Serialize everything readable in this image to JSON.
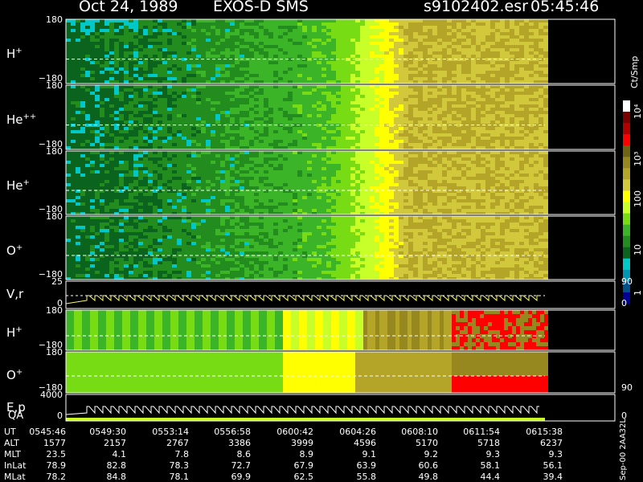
{
  "header": {
    "date": "Oct 24, 1989",
    "instrument": "EXOS-D SMS",
    "file": "s9102402.esr",
    "time": "05:45:46"
  },
  "colorbar": {
    "unit": "Ct/Smp",
    "labels": [
      "10⁴",
      "10³",
      "100",
      "10",
      "1"
    ],
    "colors": [
      "#ffffff",
      "#7a0000",
      "#b00000",
      "#ff0000",
      "#6e6414",
      "#96871e",
      "#b4a528",
      "#d2c83c",
      "#ffff00",
      "#c8ff28",
      "#78dc14",
      "#3cb428",
      "#228c1e",
      "#0a641e",
      "#00c8c8",
      "#0096b4",
      "#00508c",
      "#000096"
    ]
  },
  "panels": [
    {
      "name": "H",
      "sup": "+",
      "ytop": "180",
      "ybot": "−180"
    },
    {
      "name": "He",
      "sup": "++",
      "ytop": "180",
      "ybot": "−180"
    },
    {
      "name": "He",
      "sup": "+",
      "ytop": "180",
      "ybot": "−180"
    },
    {
      "name": "O",
      "sup": "+",
      "ytop": "180",
      "ybot": "−180"
    },
    {
      "name": "V,r",
      "sup": "",
      "ytop": "25",
      "ybot": "0",
      "rtop": "90",
      "rbot": "0"
    },
    {
      "name": "H",
      "sup": "+",
      "ytop": "180",
      "ybot": "−180"
    },
    {
      "name": "O",
      "sup": "+",
      "ytop": "180",
      "ybot": "−180",
      "rbot": "90"
    },
    {
      "name": "E,p",
      "sup": "",
      "ytop": "4000",
      "ybot": "0",
      "rbot": "0"
    }
  ],
  "qa_label": "QA",
  "chart_data": {
    "type": "heatmap",
    "title": "Oct 24, 1989   EXOS-D SMS",
    "xlabel": "UT",
    "x": [
      "0545:46",
      "0549:30",
      "0553:14",
      "0556:58",
      "0600:42",
      "0604:26",
      "0608:10",
      "0611:54",
      "0615:38"
    ],
    "colorbar_unit": "Ct/Smp",
    "colorbar_range": [
      1,
      10000
    ],
    "colorbar_scale": "log",
    "ephemeris": [
      {
        "label": "UT",
        "values": [
          "0545:46",
          "0549:30",
          "0553:14",
          "0556:58",
          "0600:42",
          "0604:26",
          "0608:10",
          "0611:54",
          "0615:38"
        ]
      },
      {
        "label": "ALT",
        "values": [
          "1577",
          "2157",
          "2767",
          "3386",
          "3999",
          "4596",
          "5170",
          "5718",
          "6237"
        ]
      },
      {
        "label": "MLT",
        "values": [
          "23.5",
          "4.1",
          "7.8",
          "8.6",
          "8.9",
          "9.1",
          "9.2",
          "9.3",
          "9.3"
        ]
      },
      {
        "label": "InLat",
        "values": [
          "78.9",
          "82.8",
          "78.3",
          "72.7",
          "67.9",
          "63.9",
          "60.6",
          "58.1",
          "56.1"
        ]
      },
      {
        "label": "MLat",
        "values": [
          "78.2",
          "84.8",
          "78.1",
          "69.9",
          "62.5",
          "55.8",
          "49.8",
          "44.4",
          "39.4"
        ]
      }
    ]
  },
  "side_meta": "Sep-00 2AA32L"
}
